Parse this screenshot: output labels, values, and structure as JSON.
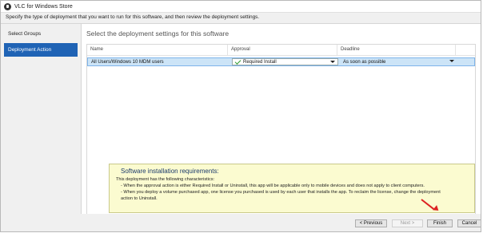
{
  "window": {
    "title": "VLC for Windows Store",
    "instruction": "Specify the type of deployment that you want to run for this software, and then review the deployment settings."
  },
  "nav": {
    "items": [
      {
        "label": "Select Groups",
        "active": false
      },
      {
        "label": "Deployment Action",
        "active": true
      }
    ]
  },
  "main": {
    "heading": "Select the deployment settings for this software",
    "columns": [
      "Name",
      "Approval",
      "Deadline"
    ],
    "rows": [
      {
        "name": "All Users/Windows 10 MDM users",
        "approval": "Required Install",
        "deadline": "As soon as possible"
      }
    ]
  },
  "requirements": {
    "title": "Software installation requirements:",
    "intro": "This deployment has the following characteristics:",
    "bullets": [
      "- When the approval action is either Required Install or Uninstall, this app will be applicable only to mobile devices and does not apply to client computers.",
      "- When you deploy a volume purchased app, one license you purchased is used by each user that installs the app. To reclaim the license, change the deployment",
      "action to Uninstall."
    ]
  },
  "footer": {
    "previous": "< Previous",
    "next": "Next >",
    "finish": "Finish",
    "cancel": "Cancel"
  },
  "colors": {
    "accent": "#1f63b5",
    "selected_row": "#cce4f7",
    "info_box": "#fbfbd0",
    "annotation_arrow": "#dd2222"
  }
}
